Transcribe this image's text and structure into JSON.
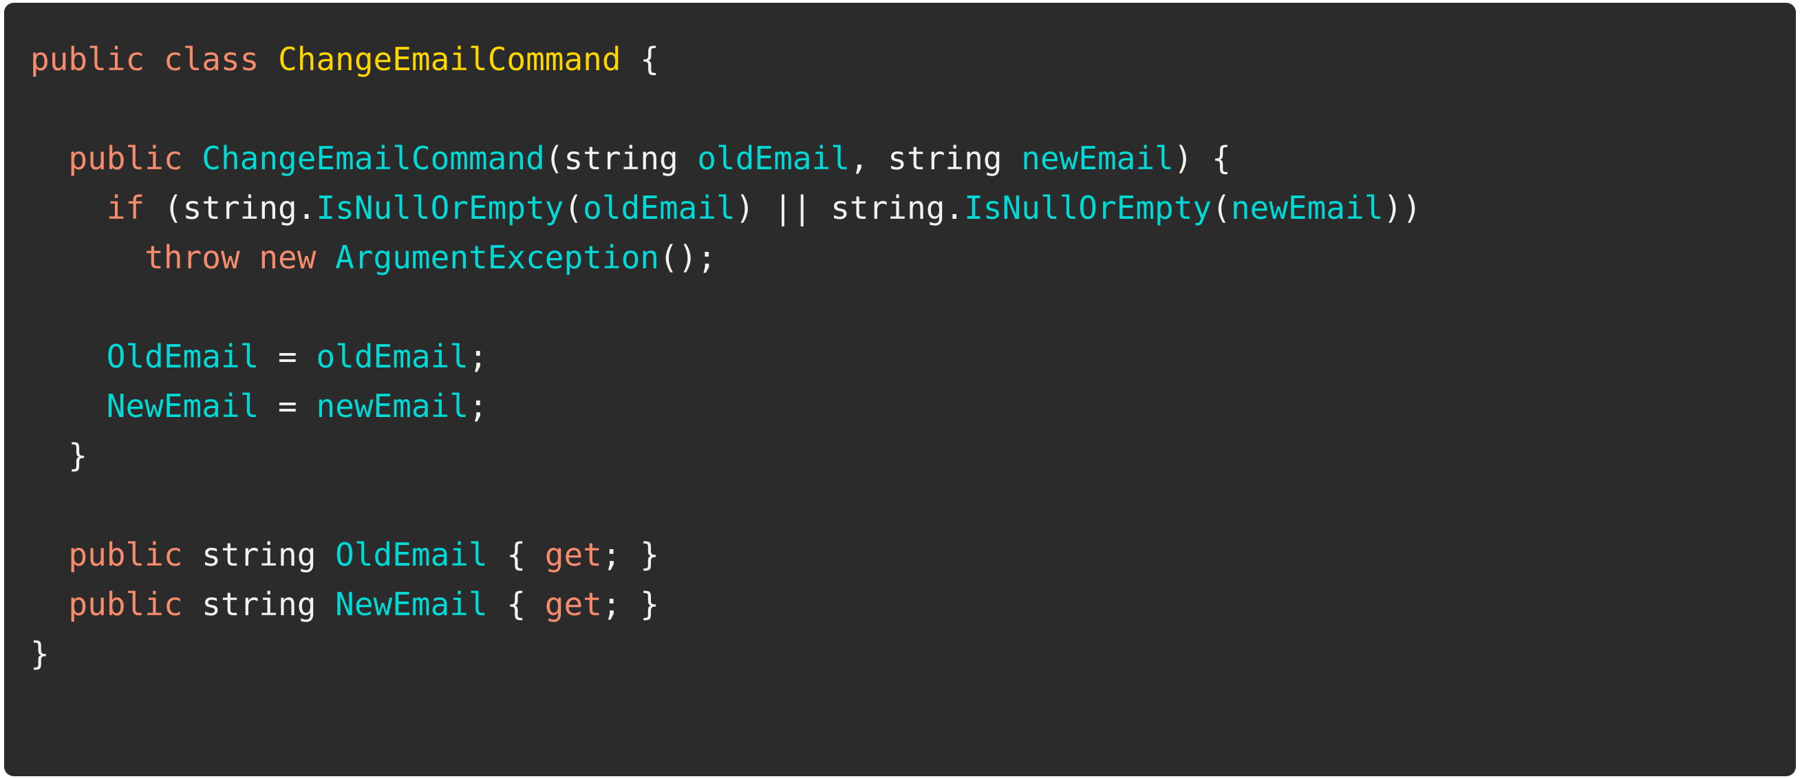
{
  "card": {
    "background_color": "#2b2b2b",
    "page_background_color": "#ffffff",
    "language": "csharp"
  },
  "palette": {
    "plain": "#f2f2ee",
    "keyword": "#f78c6c",
    "class_name": "#ffd600",
    "type": "#00d9d5",
    "identifier": "#00d9d5",
    "punctuation": "#f2f2ee"
  },
  "code": {
    "lines": [
      {
        "id": "line-1",
        "text": "public class ChangeEmailCommand {",
        "tokens": [
          {
            "t": "public",
            "k": "keyword"
          },
          {
            "t": " ",
            "k": "plain"
          },
          {
            "t": "class",
            "k": "keyword"
          },
          {
            "t": " ",
            "k": "plain"
          },
          {
            "t": "ChangeEmailCommand",
            "k": "class"
          },
          {
            "t": " ",
            "k": "plain"
          },
          {
            "t": "{",
            "k": "punct"
          }
        ]
      },
      {
        "id": "line-2",
        "text": "",
        "tokens": []
      },
      {
        "id": "line-3",
        "text": "  public ChangeEmailCommand(string oldEmail, string newEmail) {",
        "tokens": [
          {
            "t": "  ",
            "k": "plain"
          },
          {
            "t": "public",
            "k": "keyword"
          },
          {
            "t": " ",
            "k": "plain"
          },
          {
            "t": "ChangeEmailCommand",
            "k": "func"
          },
          {
            "t": "(",
            "k": "punct"
          },
          {
            "t": "string",
            "k": "plain"
          },
          {
            "t": " ",
            "k": "plain"
          },
          {
            "t": "oldEmail",
            "k": "param"
          },
          {
            "t": ", ",
            "k": "punct"
          },
          {
            "t": "string",
            "k": "plain"
          },
          {
            "t": " ",
            "k": "plain"
          },
          {
            "t": "newEmail",
            "k": "param"
          },
          {
            "t": ") ",
            "k": "punct"
          },
          {
            "t": "{",
            "k": "punct"
          }
        ]
      },
      {
        "id": "line-4",
        "text": "    if (string.IsNullOrEmpty(oldEmail) || string.IsNullOrEmpty(newEmail))",
        "tokens": [
          {
            "t": "    ",
            "k": "plain"
          },
          {
            "t": "if",
            "k": "keyword"
          },
          {
            "t": " (",
            "k": "punct"
          },
          {
            "t": "string",
            "k": "plain"
          },
          {
            "t": ".",
            "k": "punct"
          },
          {
            "t": "IsNullOrEmpty",
            "k": "func"
          },
          {
            "t": "(",
            "k": "punct"
          },
          {
            "t": "oldEmail",
            "k": "param"
          },
          {
            "t": ")",
            "k": "punct"
          },
          {
            "t": " || ",
            "k": "op"
          },
          {
            "t": "string",
            "k": "plain"
          },
          {
            "t": ".",
            "k": "punct"
          },
          {
            "t": "IsNullOrEmpty",
            "k": "func"
          },
          {
            "t": "(",
            "k": "punct"
          },
          {
            "t": "newEmail",
            "k": "param"
          },
          {
            "t": "))",
            "k": "punct"
          }
        ]
      },
      {
        "id": "line-5",
        "text": "      throw new ArgumentException();",
        "tokens": [
          {
            "t": "      ",
            "k": "plain"
          },
          {
            "t": "throw",
            "k": "keyword"
          },
          {
            "t": " ",
            "k": "plain"
          },
          {
            "t": "new",
            "k": "keyword"
          },
          {
            "t": " ",
            "k": "plain"
          },
          {
            "t": "ArgumentException",
            "k": "type"
          },
          {
            "t": "();",
            "k": "punct"
          }
        ]
      },
      {
        "id": "line-6",
        "text": "",
        "tokens": []
      },
      {
        "id": "line-7",
        "text": "    OldEmail = oldEmail;",
        "tokens": [
          {
            "t": "    ",
            "k": "plain"
          },
          {
            "t": "OldEmail",
            "k": "ident"
          },
          {
            "t": " = ",
            "k": "op"
          },
          {
            "t": "oldEmail",
            "k": "ident"
          },
          {
            "t": ";",
            "k": "punct"
          }
        ]
      },
      {
        "id": "line-8",
        "text": "    NewEmail = newEmail;",
        "tokens": [
          {
            "t": "    ",
            "k": "plain"
          },
          {
            "t": "NewEmail",
            "k": "ident"
          },
          {
            "t": " = ",
            "k": "op"
          },
          {
            "t": "newEmail",
            "k": "ident"
          },
          {
            "t": ";",
            "k": "punct"
          }
        ]
      },
      {
        "id": "line-9",
        "text": "  }",
        "tokens": [
          {
            "t": "  ",
            "k": "plain"
          },
          {
            "t": "}",
            "k": "punct"
          }
        ]
      },
      {
        "id": "line-10",
        "text": "",
        "tokens": []
      },
      {
        "id": "line-11",
        "text": "  public string OldEmail { get; }",
        "tokens": [
          {
            "t": "  ",
            "k": "plain"
          },
          {
            "t": "public",
            "k": "keyword"
          },
          {
            "t": " ",
            "k": "plain"
          },
          {
            "t": "string",
            "k": "plain"
          },
          {
            "t": " ",
            "k": "plain"
          },
          {
            "t": "OldEmail",
            "k": "ident"
          },
          {
            "t": " { ",
            "k": "punct"
          },
          {
            "t": "get",
            "k": "keyword"
          },
          {
            "t": "; }",
            "k": "punct"
          }
        ]
      },
      {
        "id": "line-12",
        "text": "  public string NewEmail { get; }",
        "tokens": [
          {
            "t": "  ",
            "k": "plain"
          },
          {
            "t": "public",
            "k": "keyword"
          },
          {
            "t": " ",
            "k": "plain"
          },
          {
            "t": "string",
            "k": "plain"
          },
          {
            "t": " ",
            "k": "plain"
          },
          {
            "t": "NewEmail",
            "k": "ident"
          },
          {
            "t": " { ",
            "k": "punct"
          },
          {
            "t": "get",
            "k": "keyword"
          },
          {
            "t": "; }",
            "k": "punct"
          }
        ]
      },
      {
        "id": "line-13",
        "text": "}",
        "tokens": [
          {
            "t": "}",
            "k": "punct"
          }
        ]
      }
    ]
  }
}
